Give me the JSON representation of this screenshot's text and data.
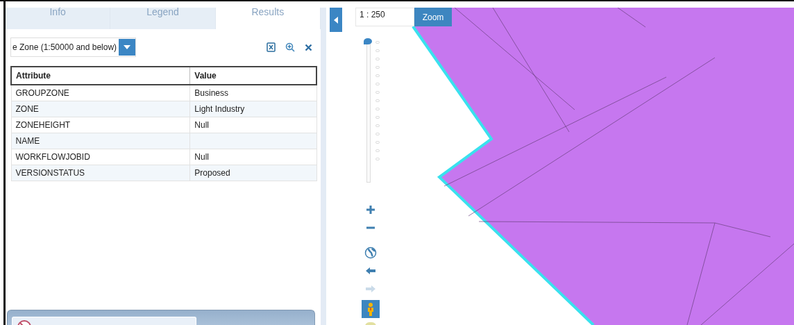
{
  "tabs": [
    {
      "label": "Info",
      "selected": false
    },
    {
      "label": "Legend",
      "selected": false
    },
    {
      "label": "Results",
      "selected": true
    }
  ],
  "layer_select": {
    "value": "e Zone (1:50000 and below)"
  },
  "table": {
    "columns": [
      "Attribute",
      "Value"
    ],
    "rows": [
      [
        "GROUPZONE",
        "Business"
      ],
      [
        "ZONE",
        "Light Industry"
      ],
      [
        "ZONEHEIGHT",
        "Null"
      ],
      [
        "NAME",
        ""
      ],
      [
        "WORKFLOWJOBID",
        "Null"
      ],
      [
        "VERSIONSTATUS",
        "Proposed"
      ]
    ]
  },
  "map": {
    "scale": "1 : 250",
    "zoom_button": "Zoom",
    "zoom_slider": {
      "level": 1
    },
    "tools": [
      {
        "kind": "zoom-in",
        "disabled": false
      },
      {
        "kind": "zoom-out",
        "disabled": false
      },
      {
        "kind": "globe",
        "disabled": false
      },
      {
        "kind": "back",
        "disabled": false
      },
      {
        "kind": "forward",
        "disabled": true
      },
      {
        "kind": "person",
        "disabled": false
      }
    ]
  }
}
